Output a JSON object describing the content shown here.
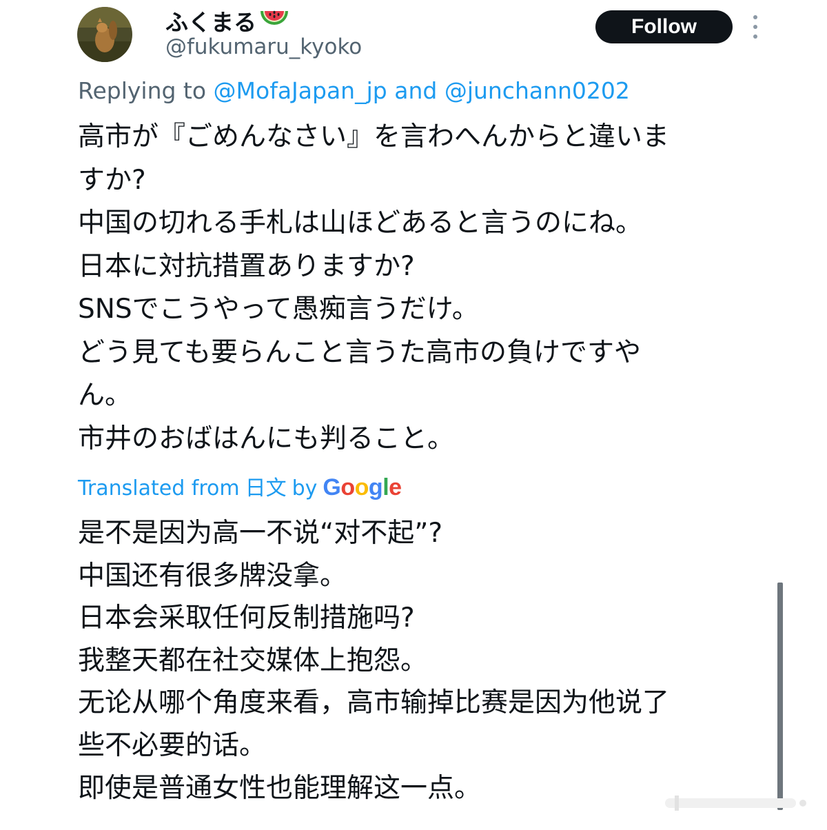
{
  "user": {
    "display_name": "ふくまる",
    "handle": "@fukumaru_kyoko",
    "name_emoji": "watermelon-icon"
  },
  "follow_label": "Follow",
  "more_icon": "more-vertical-icon",
  "reply": {
    "prefix": "Replying to",
    "mention1": "@MofaJapan_jp",
    "and": "and",
    "mention2": "@junchann0202"
  },
  "tweet_lines": [
    "高市が『ごめんなさい』を言わへんからと違いま",
    "すか?",
    "中国の切れる手札は山ほどあると言うのにね。",
    "日本に対抗措置ありますか?",
    "SNSでこうやって愚痴言うだけ。",
    "どう見ても要らんこと言うた高市の負けですや",
    "ん。",
    "市井のおばはんにも判ること。"
  ],
  "translated": {
    "prefix": "Translated from",
    "language": "日文",
    "by": "by",
    "provider": "Google"
  },
  "translation_lines": [
    "是不是因为高一不说“对不起”?",
    "中国还有很多牌没拿。",
    "日本会采取任何反制措施吗?",
    "我整天都在社交媒体上抱怨。",
    "无论从哪个角度来看，高市输掉比赛是因为他说了",
    "些不必要的话。",
    "即使是普通女性也能理解这一点。"
  ],
  "colors": {
    "text": "#0f1419",
    "secondary": "#536471",
    "link": "#1d9bf0",
    "follow_bg": "#0f1419",
    "google_blue": "#4285F4",
    "google_red": "#EA4335",
    "google_yellow": "#FBBC05",
    "google_green": "#34A853"
  }
}
